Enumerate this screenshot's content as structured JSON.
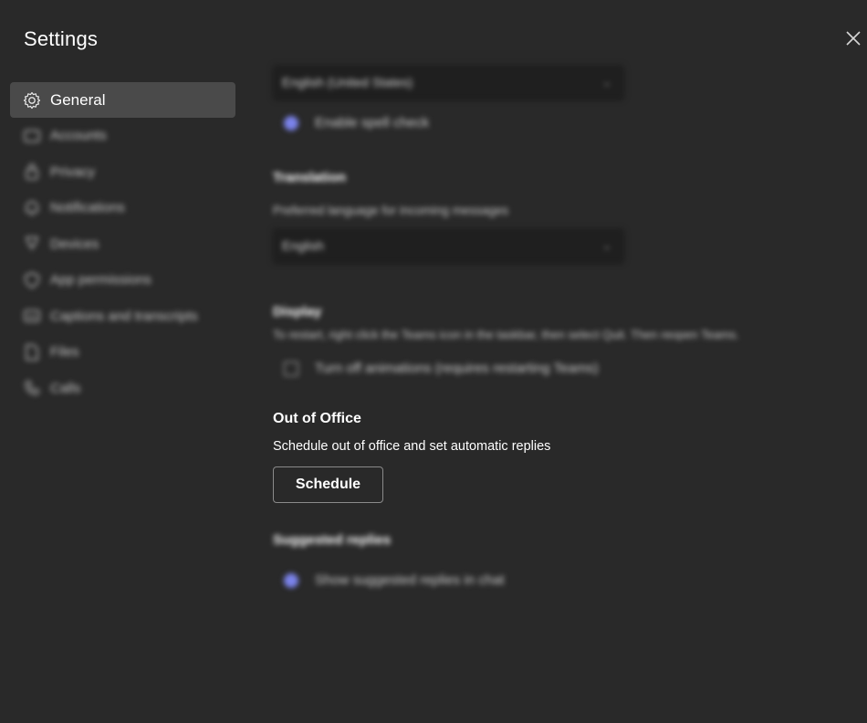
{
  "dialog": {
    "title": "Settings",
    "close_icon": "close-icon"
  },
  "sidebar": {
    "items": [
      {
        "label": "General",
        "icon": "gear-icon",
        "active": true
      },
      {
        "label": "Accounts",
        "icon": "accounts-icon",
        "active": false
      },
      {
        "label": "Privacy",
        "icon": "lock-icon",
        "active": false
      },
      {
        "label": "Notifications",
        "icon": "bell-icon",
        "active": false
      },
      {
        "label": "Devices",
        "icon": "devices-icon",
        "active": false
      },
      {
        "label": "App permissions",
        "icon": "shield-icon",
        "active": false
      },
      {
        "label": "Captions and transcripts",
        "icon": "captions-icon",
        "active": false
      },
      {
        "label": "Files",
        "icon": "file-icon",
        "active": false
      },
      {
        "label": "Calls",
        "icon": "phone-icon",
        "active": false
      }
    ]
  },
  "language": {
    "app_language_value": "English (United States)",
    "spell_check_label": "Enable spell check"
  },
  "translation": {
    "heading": "Translation",
    "description": "Preferred language for incoming messages",
    "value": "English"
  },
  "display": {
    "heading": "Display",
    "description": "To restart, right click the Teams icon in the taskbar, then select Quit. Then reopen Teams.",
    "animations_label": "Turn off animations (requires restarting Teams)"
  },
  "out_of_office": {
    "heading": "Out of Office",
    "description": "Schedule out of office and set automatic replies",
    "button_label": "Schedule"
  },
  "suggested_replies": {
    "heading": "Suggested replies",
    "toggle_label": "Show suggested replies in chat"
  },
  "colors": {
    "background": "#292929",
    "active_nav": "#4a4a4a",
    "accent": "#7b83eb"
  }
}
